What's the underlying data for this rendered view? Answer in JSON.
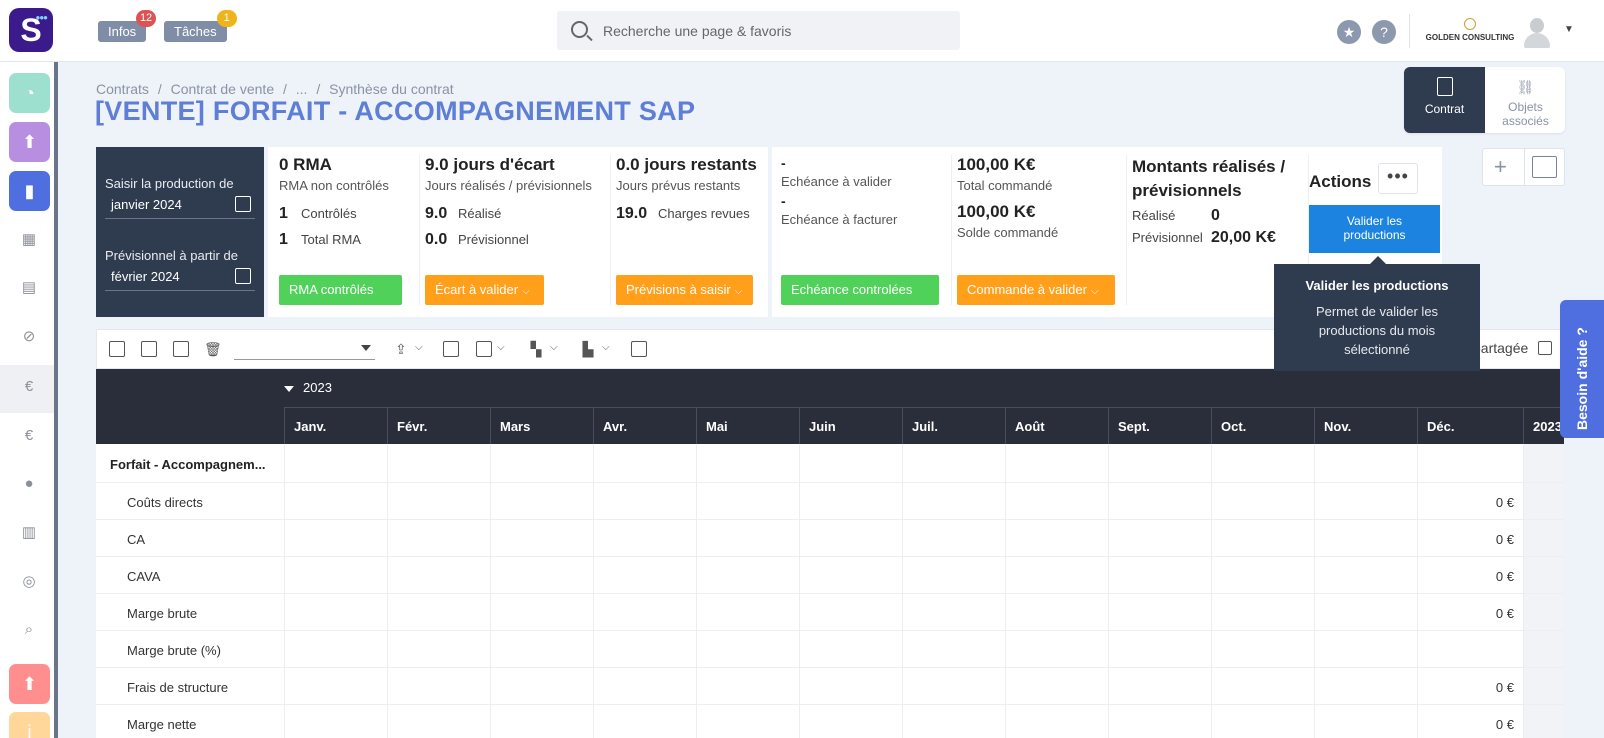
{
  "topbar": {
    "logo_letter": "S",
    "infos_label": "Infos",
    "infos_badge": "12",
    "taches_label": "Tâches",
    "taches_badge": "1",
    "search_placeholder": "Recherche une page & favoris",
    "company_name": "GOLDEN CONSULTING",
    "badge_red": "#e05252",
    "badge_yellow": "#f0b31a"
  },
  "breadcrumb": [
    "Contrats",
    "/",
    "Contrat de vente",
    "/",
    "...",
    "/",
    "Synthèse du contrat"
  ],
  "title": "[VENTE] FORFAIT - ACCOMPAGNEMENT SAP",
  "view_switch": {
    "contrat_label": "Contrat",
    "objets_label": "Objets",
    "objets_label2": "associés"
  },
  "production": {
    "saisir_label": "Saisir la production de",
    "saisir_value": "janvier 2024",
    "previsionnel_label": "Prévisionnel à partir de",
    "previsionnel_value": "février 2024"
  },
  "rma": {
    "title": "0 RMA",
    "subtitle": "RMA non contrôlés",
    "controles_value": "1",
    "controles_label": "Contrôlés",
    "total_value": "1",
    "total_label": "Total RMA",
    "button": "RMA contrôlés"
  },
  "ecart": {
    "title": "9.0 jours d'écart",
    "subtitle": "Jours réalisés / prévisionnels",
    "realise_value": "9.0",
    "realise_label": "Réalisé",
    "previsionnel_value": "0.0",
    "previsionnel_label": "Prévisionnel",
    "button": "Écart à valider"
  },
  "restants": {
    "title": "0.0 jours restants",
    "subtitle": "Jours prévus restants",
    "charges_value": "19.0",
    "charges_label": "Charges revues",
    "button": "Prévisions à saisir"
  },
  "echeance": {
    "dash1": "-",
    "valider_label": "Echéance à valider",
    "dash2": "-",
    "facturer_label": "Echéance à facturer",
    "button": "Echéance controlées"
  },
  "commande": {
    "total_value": "100,00 K€",
    "total_label": "Total commandé",
    "solde_value": "100,00 K€",
    "solde_label": "Solde commandé",
    "button": "Commande à valider"
  },
  "montants": {
    "title_line1": "Montants réalisés /",
    "title_line2": "prévisionnels",
    "realise_label": "Réalisé",
    "realise_value": "0",
    "previsionnel_label": "Prévisionnel",
    "previsionnel_value": "20,00 K€"
  },
  "actions": {
    "title": "Actions",
    "more": "•••",
    "valider_line1": "Valider les",
    "valider_line2": "productions"
  },
  "tooltip": {
    "title": "Valider les productions",
    "body": "Permet de valider les productions du mois sélectionné"
  },
  "toolbar": {
    "shared_label": "partagée"
  },
  "grid": {
    "year": "2023",
    "months": [
      "Janv.",
      "Févr.",
      "Mars",
      "Avr.",
      "Mai",
      "Juin",
      "Juil.",
      "Août",
      "Sept.",
      "Oct.",
      "Nov.",
      "Déc.",
      "2023"
    ],
    "group_label": "Forfait - Accompagnem...",
    "rows": [
      {
        "label": "Coûts directs",
        "dec": "0 €"
      },
      {
        "label": "CA",
        "dec": "0 €"
      },
      {
        "label": "CAVA",
        "dec": "0 €"
      },
      {
        "label": "Marge brute",
        "dec": "0 €"
      },
      {
        "label": "Marge brute (%)",
        "dec": ""
      },
      {
        "label": "Frais de structure",
        "dec": "0 €"
      },
      {
        "label": "Marge nette",
        "dec": "0 €"
      }
    ]
  },
  "help": "Besoin d'aide ?",
  "colors": {
    "accent_blue": "#5f7fd6",
    "green": "#4fd15a",
    "orange": "#ff9f1a",
    "action_blue": "#1c84e0",
    "dark": "#2f3b4e"
  }
}
